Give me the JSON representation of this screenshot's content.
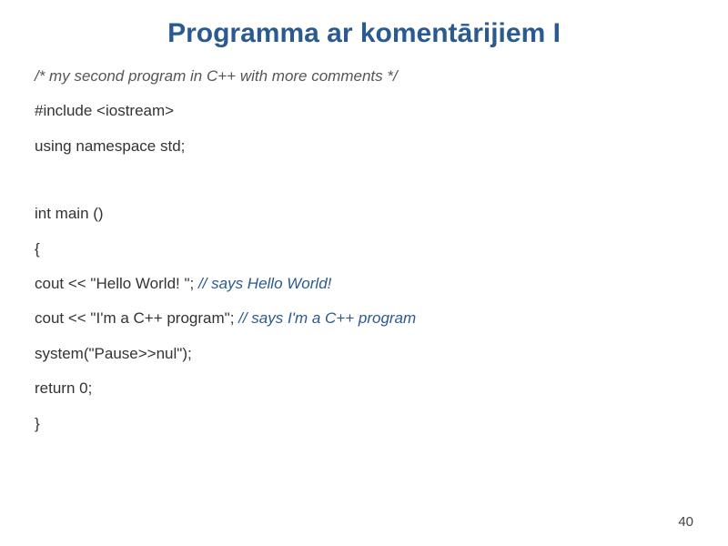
{
  "title": "Programma ar komentārijiem I",
  "code": {
    "line1_comment": "/* my second program in C++ with more comments */",
    "line2": "#include <iostream>",
    "line3": "using namespace std;",
    "line4": "int main ()",
    "line5": "{",
    "line6_code": "cout << \"Hello World! \"; ",
    "line6_comment": "// says Hello World!",
    "line7_code": "cout << \"I'm a C++ program\"; ",
    "line7_comment": "// says I'm a C++ program",
    "line8": "system(\"Pause>>nul\");",
    "line9": "return 0;",
    "line10": "}"
  },
  "page_number": "40"
}
